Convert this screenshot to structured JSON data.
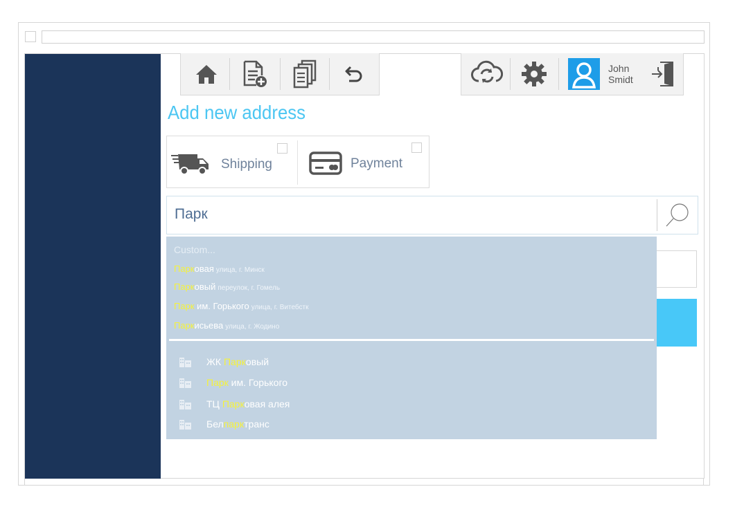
{
  "header": {
    "title": "Add new address",
    "user": {
      "first_name": "John",
      "last_name": "Smidt"
    }
  },
  "toolbar": {
    "left_icons": [
      "home-icon",
      "add-document-icon",
      "documents-icon",
      "undo-icon"
    ],
    "right_icons": [
      "cloud-sync-icon",
      "gear-icon",
      "user-avatar-icon",
      "logout-icon"
    ]
  },
  "options": [
    {
      "label": "Shipping",
      "icon": "truck-icon",
      "checked": false
    },
    {
      "label": "Payment",
      "icon": "credit-card-icon",
      "checked": false
    }
  ],
  "search": {
    "value": "Парк",
    "icon": "search-icon"
  },
  "dropdown": {
    "custom_label": "Custom...",
    "streets": [
      {
        "pre": "",
        "hl": "Парк",
        "post": "овая",
        "detail": "улица, г. Минск"
      },
      {
        "pre": "",
        "hl": "Парк",
        "post": "овый",
        "detail": "переулок, г. Гомель"
      },
      {
        "pre": "",
        "hl": "Парк",
        "post": " им. Горького",
        "detail": "улица, г. Витебстк"
      },
      {
        "pre": "",
        "hl": "Парк",
        "post": "исьева",
        "detail": "улица, г. Жодино"
      }
    ],
    "places": [
      {
        "pre": "ЖК ",
        "hl": "Парк",
        "post": "овый"
      },
      {
        "pre": "",
        "hl": "Парк",
        "post": " им. Горького"
      },
      {
        "pre": "ТЦ ",
        "hl": "Парк",
        "post": "овая алея"
      },
      {
        "pre": "Бел",
        "hl": "парк",
        "post": "транс"
      }
    ],
    "place_icon": "building-icon"
  },
  "colors": {
    "sidebar": "#1b3459",
    "accent": "#4cc6f2",
    "dropdown_bg": "#c2d3e2",
    "highlight": "#f6f23a"
  }
}
